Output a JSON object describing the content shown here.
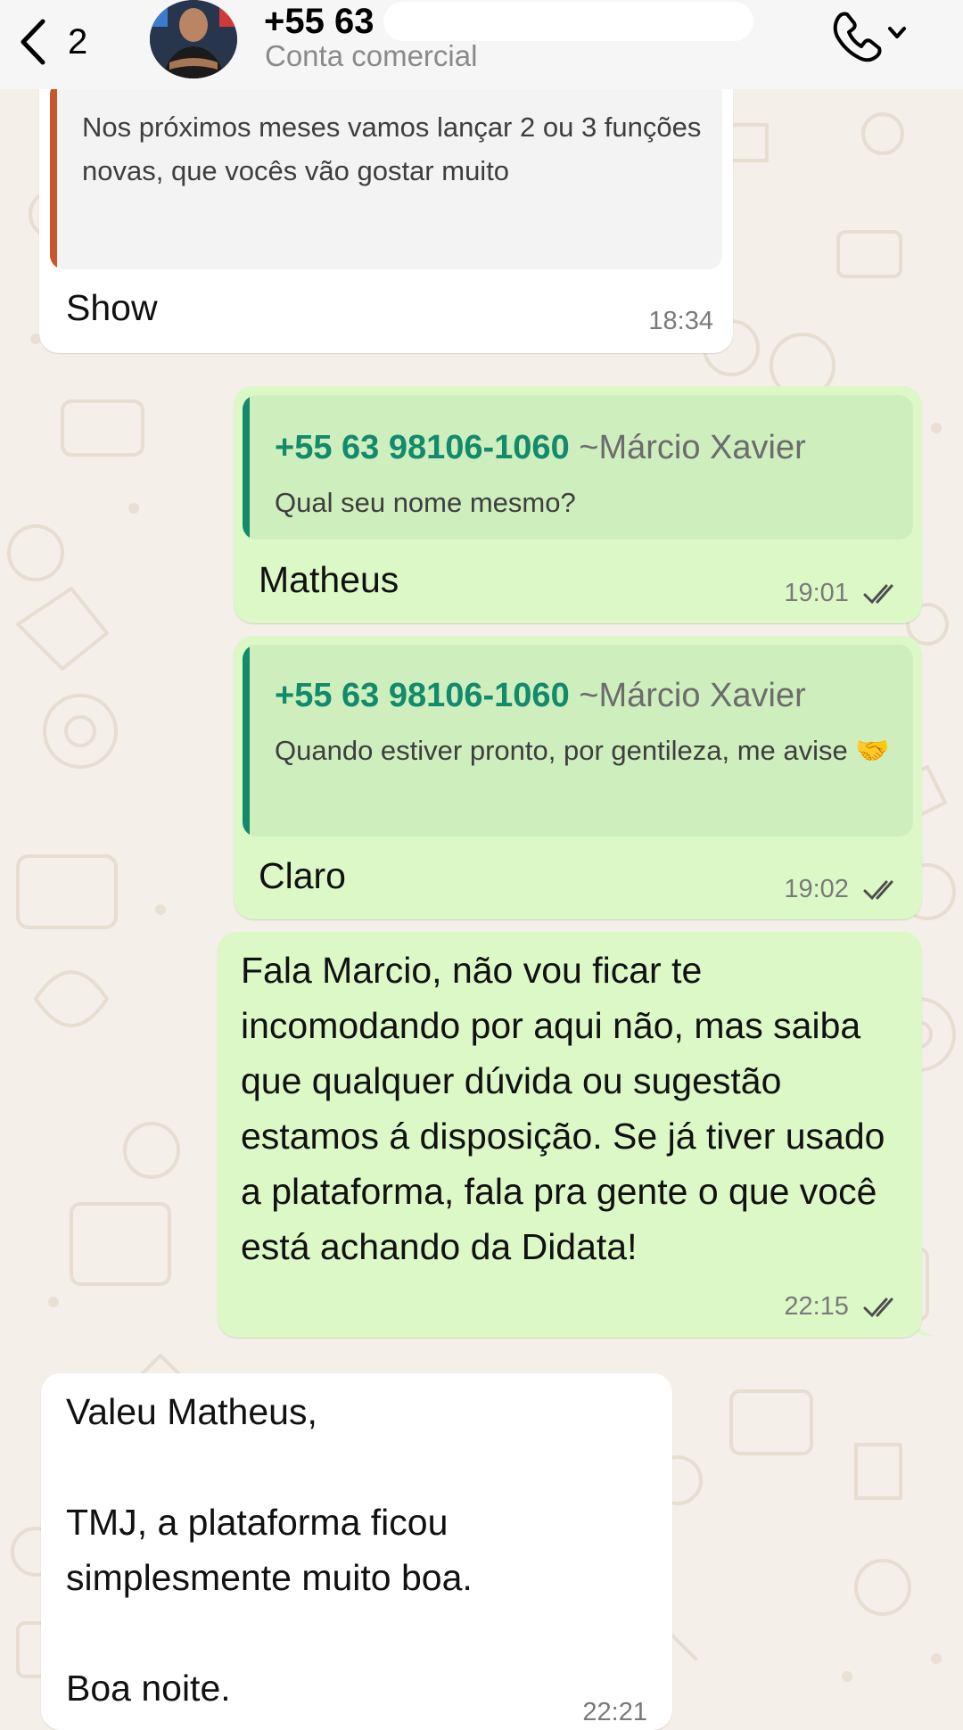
{
  "header": {
    "back_count": "2",
    "contact_name": "+55 63",
    "contact_subtitle": "Conta comercial"
  },
  "messages": [
    {
      "direction": "incoming",
      "quote_text": "Nos próximos meses vamos lançar 2 ou 3 funções novas, que vocês vão gostar muito",
      "text": "Show",
      "time": "18:34"
    },
    {
      "direction": "outgoing",
      "quote_number": "+55 63 98106-1060",
      "quote_nick": "~Márcio Xavier",
      "quote_text": "Qual seu nome mesmo?",
      "text": "Matheus",
      "time": "19:01"
    },
    {
      "direction": "outgoing",
      "quote_number": "+55 63 98106-1060",
      "quote_nick": "~Márcio Xavier",
      "quote_text": "Quando estiver pronto, por gentileza, me avise 🤝",
      "text": "Claro",
      "time": "19:02"
    },
    {
      "direction": "outgoing",
      "text": "Fala Marcio, não vou ficar te incomodando por aqui não, mas saiba que qualquer dúvida ou sugestão estamos á disposição. Se já tiver usado a plataforma, fala pra gente o que você está achando da Didata!",
      "time": "22:15"
    },
    {
      "direction": "incoming",
      "text": "Valeu Matheus,\n\nTMJ, a plataforma ficou simplesmente muito boa.\n\nBoa noite.",
      "time": "22:21"
    }
  ],
  "colors": {
    "outgoing_bubble": "#dbf8c6",
    "incoming_bubble": "#ffffff",
    "quote_accent_outgoing": "#128a6c",
    "quote_accent_incoming": "#c8562b",
    "wallpaper": "#f4efe8",
    "read_ticks": "#4d4d4d"
  },
  "icons": [
    "chevron-left-icon",
    "phone-icon",
    "chevron-down-icon",
    "double-check-icon"
  ]
}
